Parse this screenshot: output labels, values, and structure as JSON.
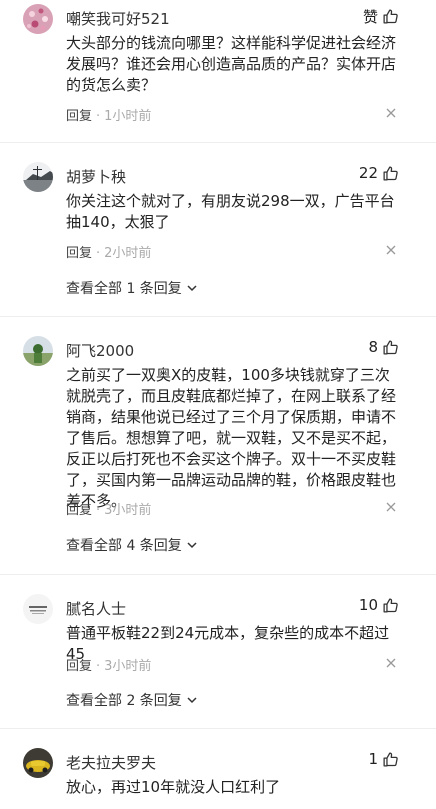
{
  "comments": [
    {
      "name": "嘲笑我可好521",
      "like": "赞",
      "text": "大头部分的钱流向哪里？这样能科学促进社会经济发展吗？谁还会用心创造高品质的产品？实体开店的货怎么卖？",
      "reply": "回复",
      "time": "1小时前"
    },
    {
      "name": "胡萝卜秧",
      "like": "22",
      "text": "你关注这个就对了，有朋友说298一双，广告平台抽140，太狠了",
      "reply": "回复",
      "time": "2小时前",
      "view_all": "查看全部 1 条回复"
    },
    {
      "name": "阿飞2000",
      "like": "8",
      "text": "之前买了一双奥X的皮鞋，100多块钱就穿了三次就脱壳了，而且皮鞋底都烂掉了，在网上联系了经销商，结果他说已经过了三个月了保质期，申请不了售后。想想算了吧，就一双鞋，又不是买不起，反正以后打死也不会买这个牌子。双十一不买皮鞋了，买国内第一品牌运动品牌的鞋，价格跟皮鞋也差不多。",
      "reply": "回复",
      "time": "3小时前",
      "view_all": "查看全部 4 条回复"
    },
    {
      "name": "腻名人士",
      "like": "10",
      "text": "普通平板鞋22到24元成本，复杂些的成本不超过45",
      "reply": "回复",
      "time": "3小时前",
      "view_all": "查看全部 2 条回复"
    },
    {
      "name": "老夫拉夫罗夫",
      "like": "1",
      "text": "放心，再过10年就没人口红利了"
    }
  ]
}
